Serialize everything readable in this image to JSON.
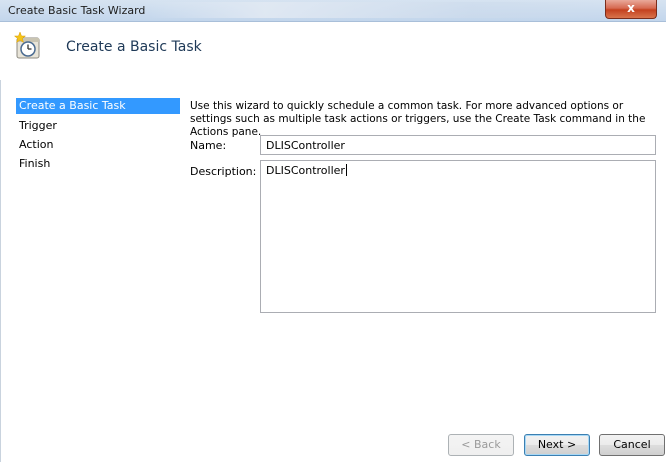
{
  "window": {
    "title": "Create Basic Task Wizard",
    "close_label": "x"
  },
  "header": {
    "title": "Create a Basic Task",
    "icon": "task-clock-icon"
  },
  "sidebar": {
    "items": [
      {
        "label": "Create a Basic Task",
        "active": true
      },
      {
        "label": "Trigger",
        "active": false
      },
      {
        "label": "Action",
        "active": false
      },
      {
        "label": "Finish",
        "active": false
      }
    ]
  },
  "main": {
    "intro_text": "Use this wizard to quickly schedule a common task.  For more advanced options or settings such as multiple task actions or triggers, use the Create Task command in the Actions pane.",
    "name_label": "Name:",
    "name_value": "DLISController",
    "description_label": "Description:",
    "description_value": "DLISController"
  },
  "buttons": {
    "back": "< Back",
    "next": "Next >",
    "cancel": "Cancel"
  },
  "colors": {
    "selection": "#3399ff",
    "title_text": "#1e3957"
  }
}
